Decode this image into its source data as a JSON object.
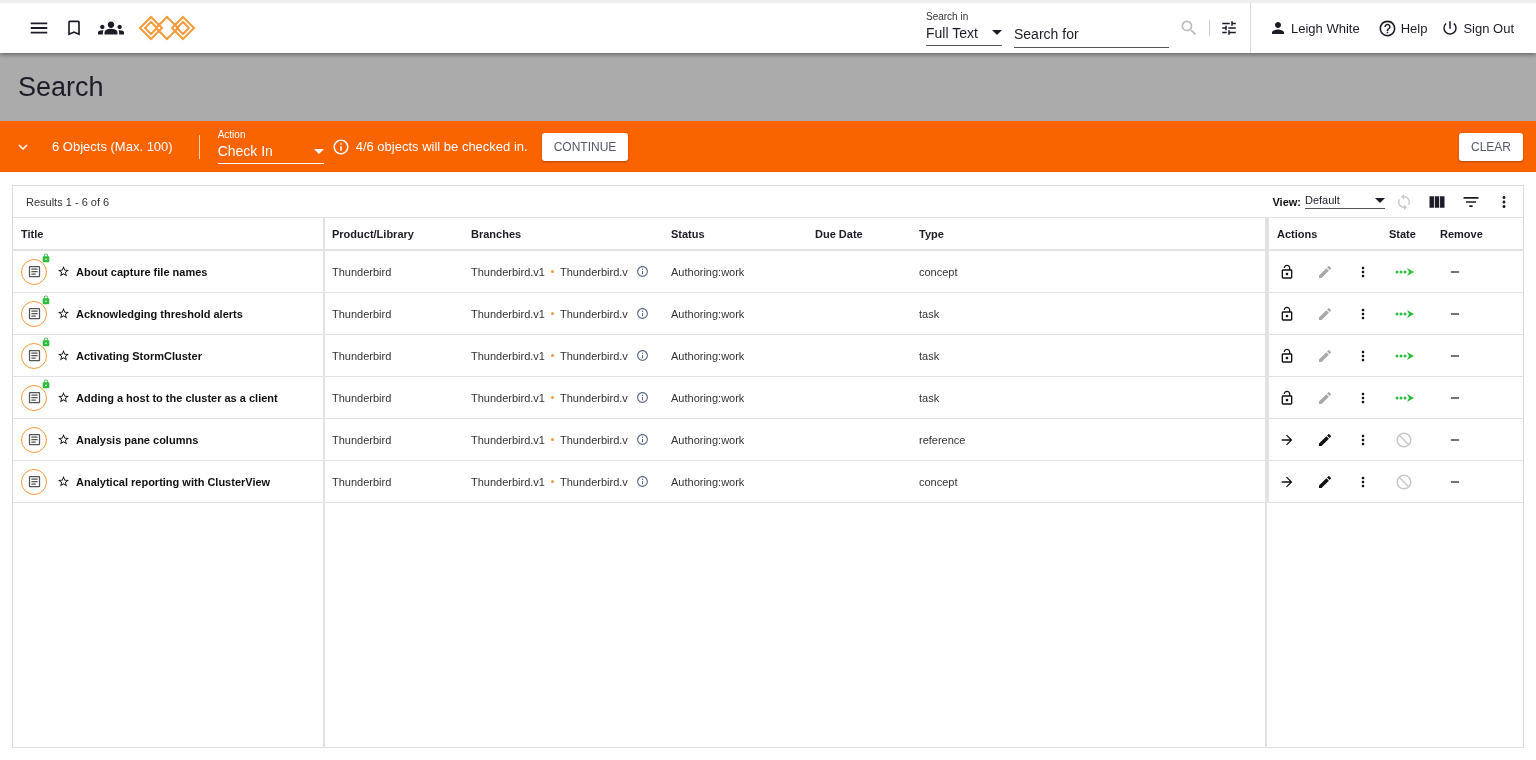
{
  "header": {
    "search_in_label": "Search in",
    "search_in_value": "Full Text",
    "search_placeholder": "Search for",
    "user": "Leigh White",
    "help": "Help",
    "sign_out": "Sign Out"
  },
  "page_title": "Search",
  "selection_bar": {
    "count": "6 Objects (Max. 100)",
    "action_label": "Action",
    "action_value": "Check In",
    "info": "4/6 objects will be checked in.",
    "continue": "CONTINUE",
    "clear": "CLEAR"
  },
  "results": {
    "summary": "Results 1 - 6 of 6",
    "view_label": "View:",
    "view_value": "Default",
    "columns": [
      "Title",
      "Product/Library",
      "Branches",
      "Status",
      "Due Date",
      "Type"
    ],
    "action_columns": [
      "Actions",
      "State",
      "Remove"
    ],
    "rows": [
      {
        "title": "About capture file names",
        "locked": true,
        "product": "Thunderbird",
        "branch_1": "Thunderbird.v1",
        "branch_2": "Thunderbird.v",
        "status": "Authoring:work",
        "type": "concept",
        "unlockable": true,
        "edit_enabled": false,
        "ready": true
      },
      {
        "title": "Acknowledging threshold alerts",
        "locked": true,
        "product": "Thunderbird",
        "branch_1": "Thunderbird.v1",
        "branch_2": "Thunderbird.v",
        "status": "Authoring:work",
        "type": "task",
        "unlockable": true,
        "edit_enabled": false,
        "ready": true
      },
      {
        "title": "Activating StormCluster",
        "locked": true,
        "product": "Thunderbird",
        "branch_1": "Thunderbird.v1",
        "branch_2": "Thunderbird.v",
        "status": "Authoring:work",
        "type": "task",
        "unlockable": true,
        "edit_enabled": false,
        "ready": true
      },
      {
        "title": "Adding a host to the cluster as a client",
        "locked": true,
        "product": "Thunderbird",
        "branch_1": "Thunderbird.v1",
        "branch_2": "Thunderbird.v",
        "status": "Authoring:work",
        "type": "task",
        "unlockable": true,
        "edit_enabled": false,
        "ready": true
      },
      {
        "title": "Analysis pane columns",
        "locked": false,
        "product": "Thunderbird",
        "branch_1": "Thunderbird.v1",
        "branch_2": "Thunderbird.v",
        "status": "Authoring:work",
        "type": "reference",
        "unlockable": false,
        "edit_enabled": true,
        "ready": false
      },
      {
        "title": "Analytical reporting with ClusterView",
        "locked": false,
        "product": "Thunderbird",
        "branch_1": "Thunderbird.v1",
        "branch_2": "Thunderbird.v",
        "status": "Authoring:work",
        "type": "concept",
        "unlockable": false,
        "edit_enabled": true,
        "ready": false
      }
    ]
  }
}
